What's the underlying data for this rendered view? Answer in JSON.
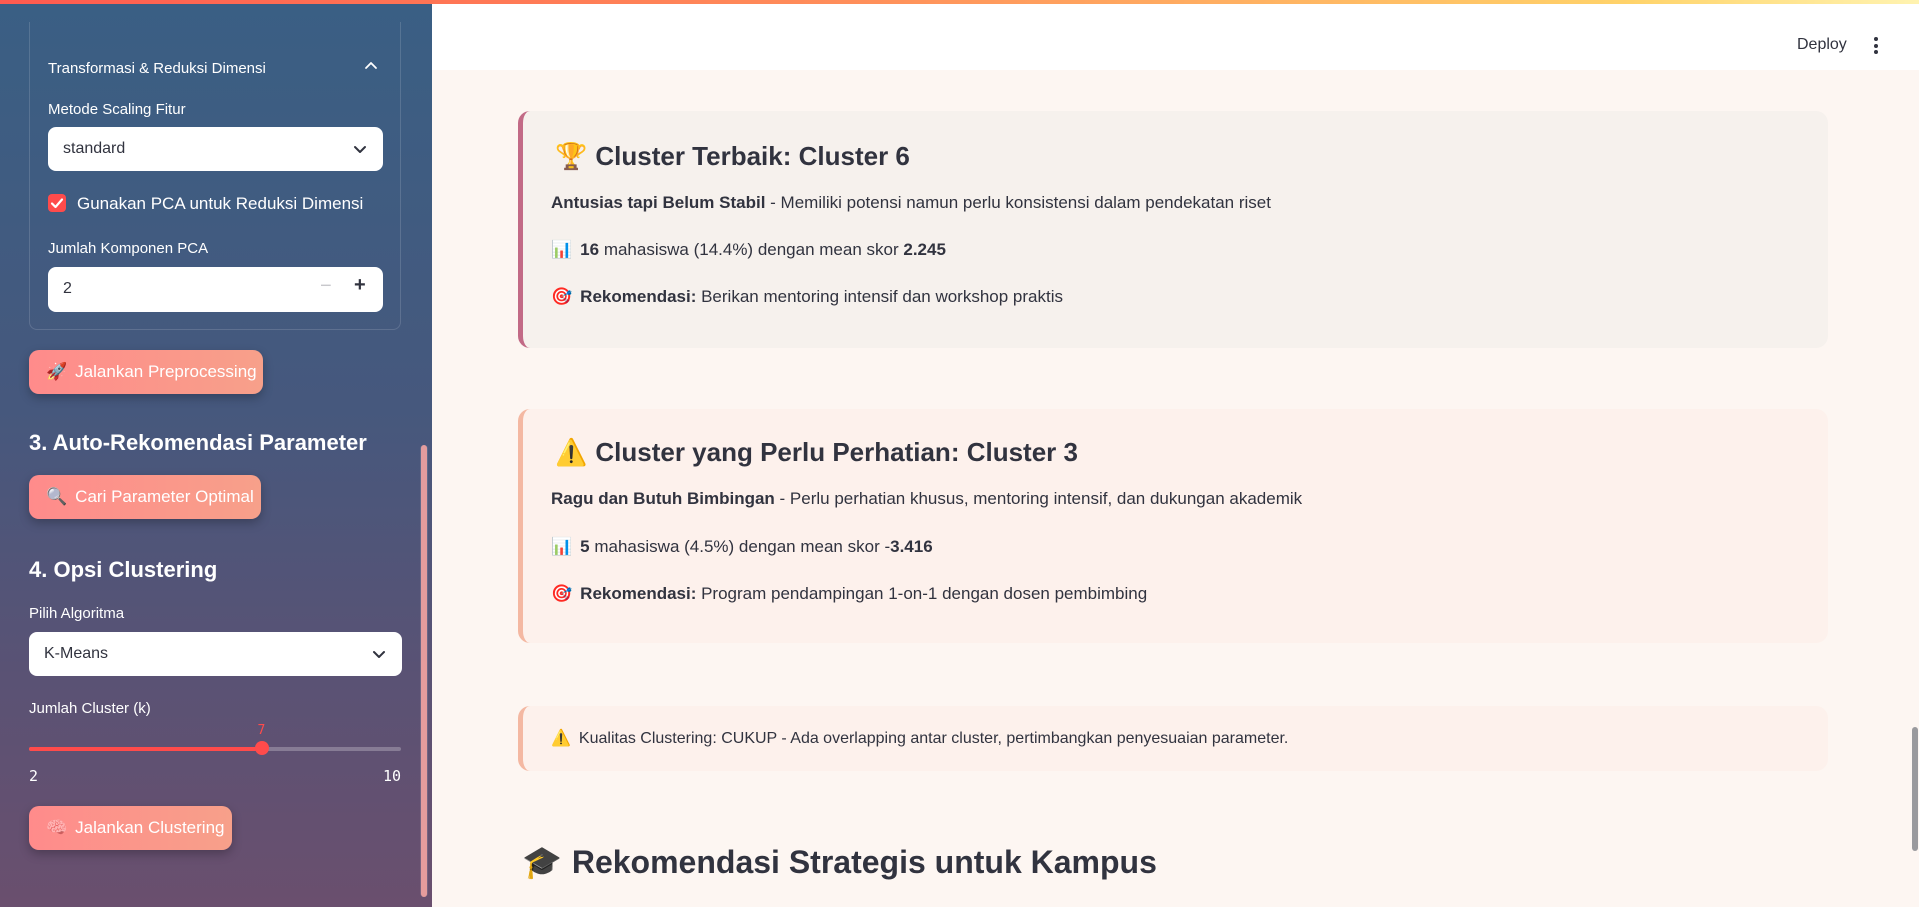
{
  "sidebar": {
    "expander_title": "Transformasi & Reduksi Dimensi",
    "scaling_label": "Metode Scaling Fitur",
    "scaling_value": "standard",
    "pca_checkbox_label": "Gunakan PCA untuk Reduksi Dimensi",
    "pca_checked": true,
    "pca_components_label": "Jumlah Komponen PCA",
    "pca_components_value": "2",
    "preprocess_button": "Jalankan Preprocessing",
    "preprocess_icon": "🚀",
    "section3_title": "3. Auto-Rekomendasi Parameter",
    "optimal_button": "Cari Parameter Optimal",
    "optimal_icon": "🔍",
    "section4_title": "4. Opsi Clustering",
    "algorithm_label": "Pilih Algoritma",
    "algorithm_value": "K-Means",
    "k_label": "Jumlah Cluster (k)",
    "k_value": "7",
    "k_min": "2",
    "k_max": "10",
    "k_fraction": 0.625,
    "cluster_button": "Jalankan Clustering",
    "cluster_icon": "🧠"
  },
  "header": {
    "deploy_label": "Deploy"
  },
  "main": {
    "best": {
      "icon": "🏆",
      "title": "Cluster Terbaik: Cluster 6",
      "name": "Antusias tapi Belum Stabil",
      "desc": " - Memiliki potensi namun perlu konsistensi dalam pendekatan riset",
      "stat_icon": "📊",
      "count": "16",
      "stat_text": " mahasiswa (14.4%) dengan mean skor ",
      "score": "2.245",
      "rec_icon": "🎯",
      "rec_label": "Rekomendasi:",
      "rec_text": " Berikan mentoring intensif dan workshop praktis"
    },
    "attention": {
      "icon": "⚠️",
      "title": "Cluster yang Perlu Perhatian: Cluster 3",
      "name": "Ragu dan Butuh Bimbingan",
      "desc": " - Perlu perhatian khusus, mentoring intensif, dan dukungan akademik",
      "stat_icon": "📊",
      "count": "5",
      "stat_text": " mahasiswa (4.5%) dengan mean skor -",
      "score": "3.416",
      "rec_icon": "🎯",
      "rec_label": "Rekomendasi:",
      "rec_text": " Program pendampingan 1-on-1 dengan dosen pembimbing"
    },
    "quality": {
      "icon": "⚠️",
      "text": "Kualitas Clustering: CUKUP - Ada overlapping antar cluster, pertimbangkan penyesuaian parameter."
    },
    "strategy": {
      "icon": "🎓",
      "title": "Rekomendasi Strategis untuk Kampus"
    }
  },
  "colors": {
    "accent": "#ff4b4b",
    "button_gradient_start": "#ff8b8b",
    "button_gradient_end": "#f7a08a"
  }
}
